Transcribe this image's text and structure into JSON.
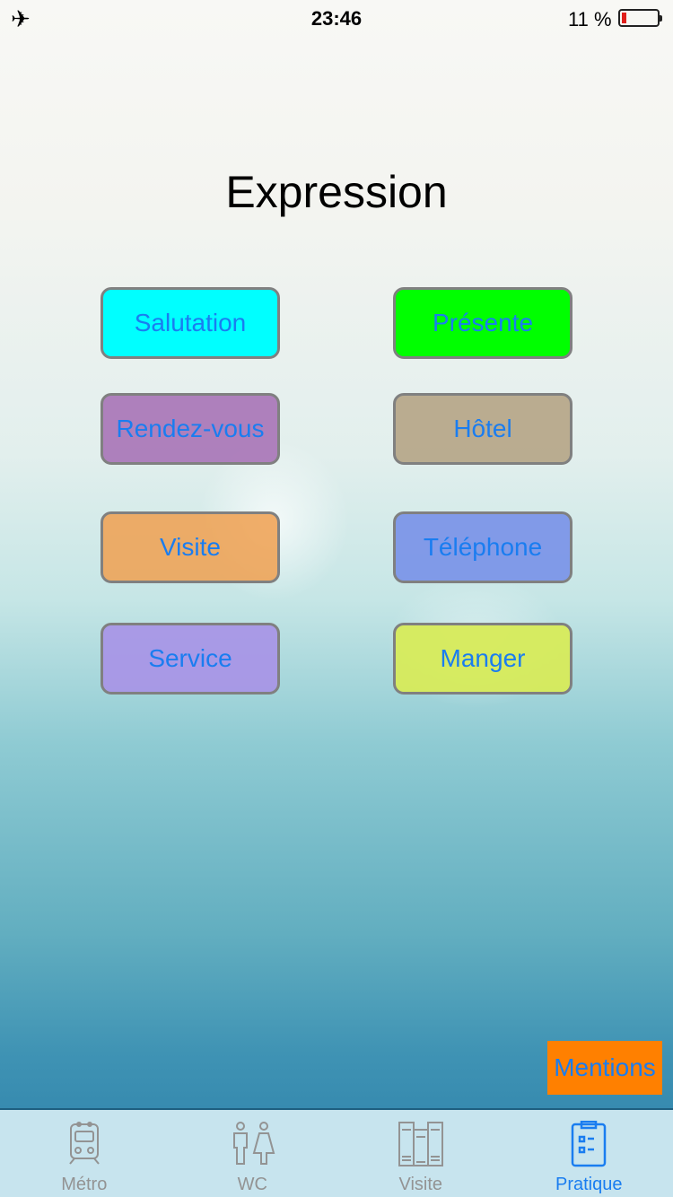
{
  "status": {
    "time": "23:46",
    "battery_text": "11 %",
    "battery_level": 0.11,
    "icon": "airplane-icon"
  },
  "title": "Expression",
  "buttons": [
    {
      "label": "Salutation",
      "color": "#00ffff"
    },
    {
      "label": "Présente",
      "color": "#00ff00"
    },
    {
      "label": "Rendez-vous",
      "color": "#b07ab8"
    },
    {
      "label": "Hôtel",
      "color": "#b8a58a"
    },
    {
      "label": "Visite",
      "color": "#f0a85a"
    },
    {
      "label": "Téléphone",
      "color": "#7f98e8"
    },
    {
      "label": "Service",
      "color": "#a896e0"
    },
    {
      "label": "Manger",
      "color": "#d4ea5c"
    }
  ],
  "mentions": "Mentions",
  "tabs": [
    {
      "label": "Métro",
      "icon": "train-icon"
    },
    {
      "label": "WC",
      "icon": "restroom-icon"
    },
    {
      "label": "Visite",
      "icon": "books-icon"
    },
    {
      "label": "Pratique",
      "icon": "clipboard-icon",
      "active": true
    }
  ]
}
